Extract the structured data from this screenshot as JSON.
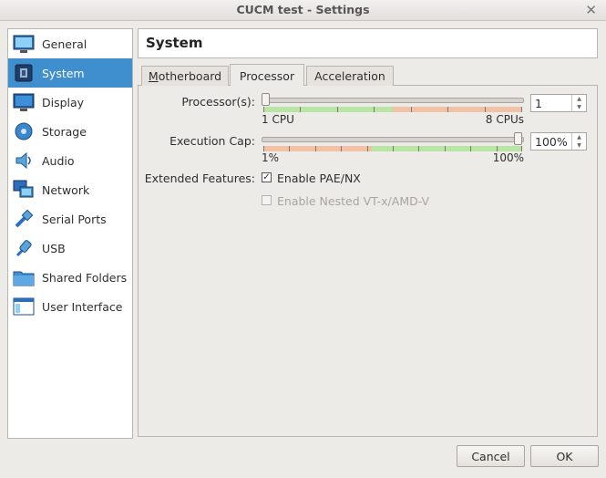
{
  "window": {
    "title": "CUCM test - Settings",
    "close_glyph": "✕"
  },
  "sidebar": {
    "items": [
      {
        "label": "General",
        "icon": "general-icon",
        "selected": false
      },
      {
        "label": "System",
        "icon": "system-icon",
        "selected": true
      },
      {
        "label": "Display",
        "icon": "display-icon",
        "selected": false
      },
      {
        "label": "Storage",
        "icon": "storage-icon",
        "selected": false
      },
      {
        "label": "Audio",
        "icon": "audio-icon",
        "selected": false
      },
      {
        "label": "Network",
        "icon": "network-icon",
        "selected": false
      },
      {
        "label": "Serial Ports",
        "icon": "serial-ports-icon",
        "selected": false
      },
      {
        "label": "USB",
        "icon": "usb-icon",
        "selected": false
      },
      {
        "label": "Shared Folders",
        "icon": "shared-folders-icon",
        "selected": false
      },
      {
        "label": "User Interface",
        "icon": "user-interface-icon",
        "selected": false
      }
    ]
  },
  "header": {
    "title": "System"
  },
  "tabs": [
    {
      "label": "Motherboard",
      "active": false
    },
    {
      "label": "Processor",
      "active": true
    },
    {
      "label": "Acceleration",
      "active": false
    }
  ],
  "processor": {
    "processors_label": "Processor(s):",
    "processors_value": "1",
    "processors_min_label": "1 CPU",
    "processors_max_label": "8 CPUs",
    "processors_fraction": 0,
    "exec_cap_label": "Execution Cap:",
    "exec_cap_value": "100%",
    "exec_cap_min_label": "1%",
    "exec_cap_max_label": "100%",
    "exec_cap_fraction": 1,
    "extended_label": "Extended Features:",
    "pae_label": "Enable PAE/NX",
    "pae_checked": true,
    "nested_label": "Enable Nested VT-x/AMD-V",
    "nested_checked": false,
    "nested_enabled": false
  },
  "buttons": {
    "cancel": "Cancel",
    "ok": "OK"
  },
  "colors": {
    "selection": "#3f8fcf",
    "scale_green": "#b9e6a7",
    "scale_red": "#f2c2a7"
  }
}
